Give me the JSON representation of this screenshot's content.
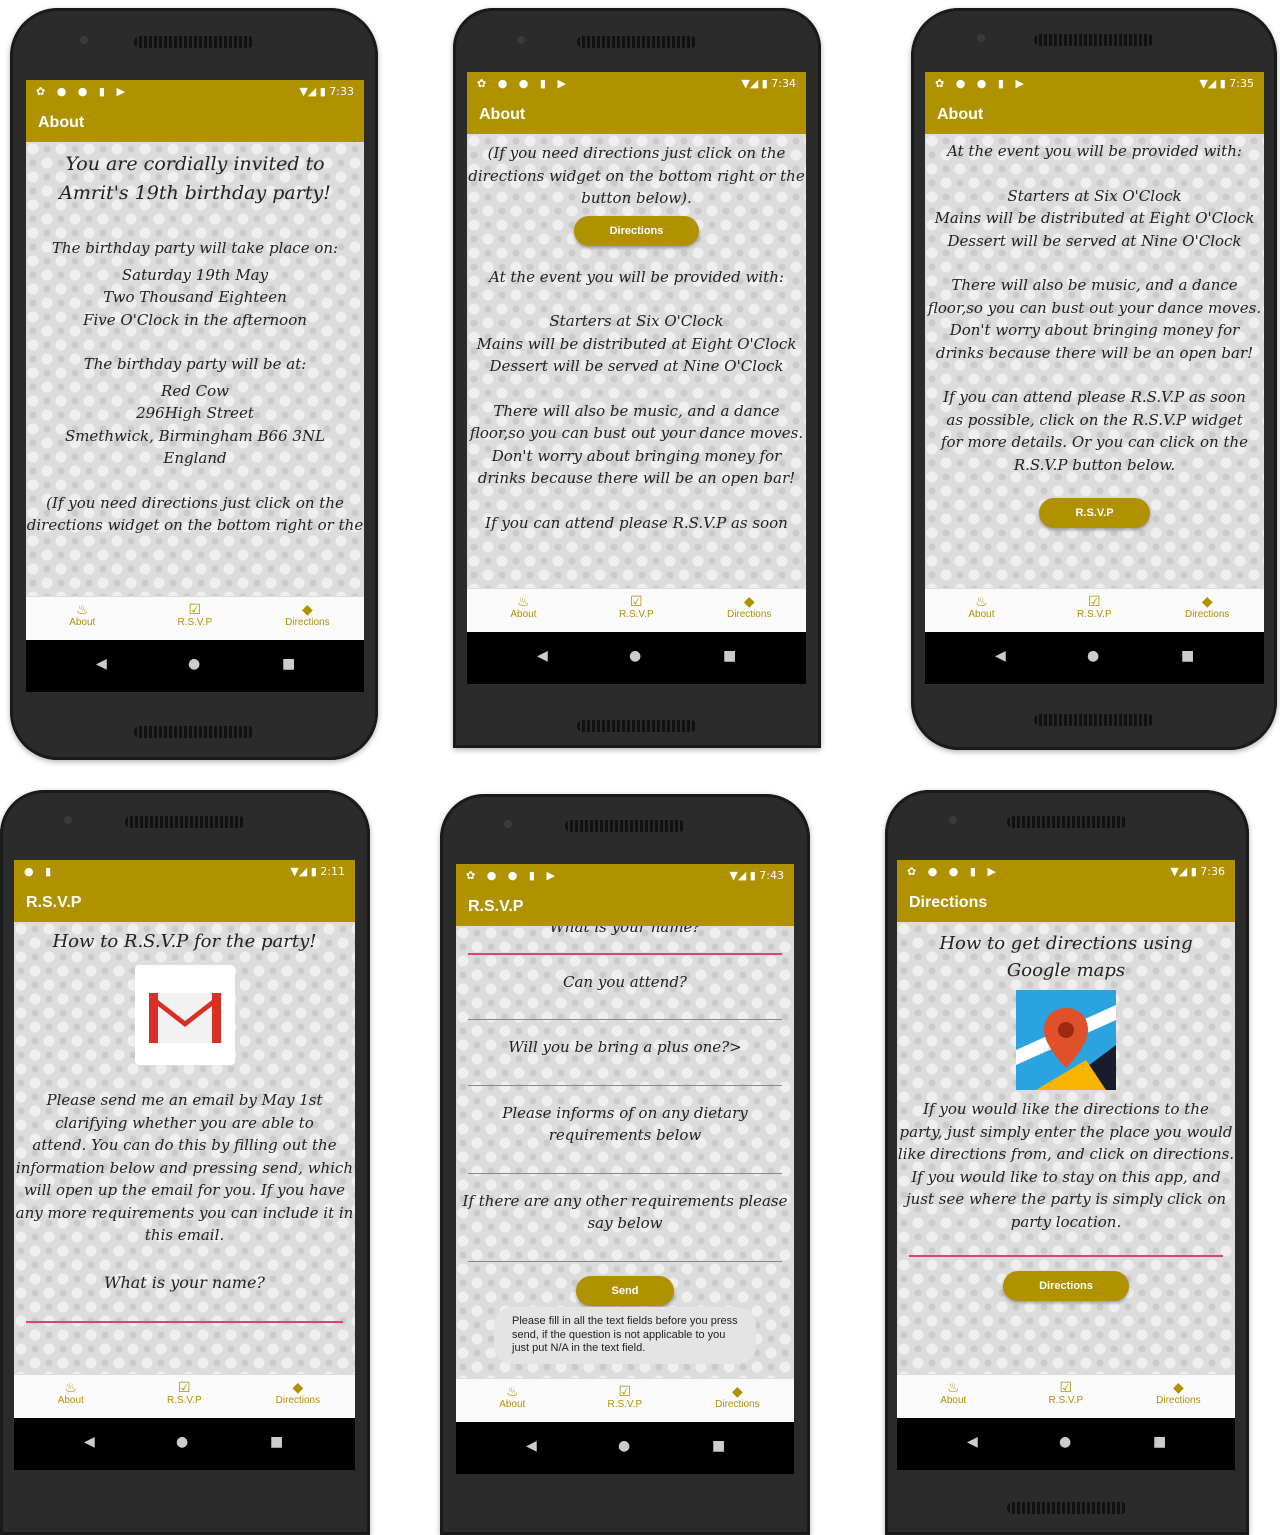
{
  "nav": {
    "about": "About",
    "rsvp": "R.S.V.P",
    "directions": "Directions"
  },
  "screens": [
    {
      "time": "7:33",
      "title": "About",
      "heading1": "You are cordially invited to",
      "heading2": "Amrit's 19th birthday party!",
      "p1": "The birthday party will take place on:",
      "p2": "Saturday 19th May",
      "p3": "Two Thousand Eighteen",
      "p4": "Five O'Clock in the afternoon",
      "p5": "The birthday party will be at:",
      "p6": "Red Cow",
      "p7": "296High Street",
      "p8": "Smethwick, Birmingham B66 3NL",
      "p9": "England",
      "p10": "(If you need directions just click on the",
      "p11": "directions widget on the bottom right or the"
    },
    {
      "time": "7:34",
      "title": "About",
      "p1": "(If you need directions just click on the",
      "p2": "directions widget on the bottom right or the",
      "p3": "button below).",
      "button": "Directions",
      "p4": "At the event you will be provided with:",
      "p5": "Starters at Six O'Clock",
      "p6": "Mains will be distributed at Eight O'Clock",
      "p7": "Dessert will be served at Nine O'Clock",
      "p8": "There will also be music, and a dance",
      "p9": "floor,so you can bust out your dance moves.",
      "p10": "Don't worry about bringing money for",
      "p11": "drinks because there will be an open bar!",
      "p12": "If you can attend please R.S.V.P as soon"
    },
    {
      "time": "7:35",
      "title": "About",
      "p1": "At the event you will be provided with:",
      "p2": "Starters at Six O'Clock",
      "p3": "Mains will be distributed at Eight O'Clock",
      "p4": "Dessert will be served at Nine O'Clock",
      "p5": "There will also be music, and a dance",
      "p6": "floor,so you can bust out your dance moves.",
      "p7": "Don't worry about bringing money for",
      "p8": "drinks because there will be an open bar!",
      "p9": "If you can attend please R.S.V.P as soon",
      "p10": "as possible, click on the R.S.V.P widget",
      "p11": "for more details. Or you can click on the",
      "p12": "R.S.V.P button below.",
      "button": "R.S.V.P"
    },
    {
      "time": "2:11",
      "title": "R.S.V.P",
      "heading": "How to R.S.V.P for the party!",
      "p1": "Please send me an email by May 1st",
      "p2": "clarifying whether you are able to",
      "p3": "attend. You can do this by filling out the",
      "p4": "information below and pressing send, which",
      "p5": "will open up the email for you. If you have",
      "p6": "any more requirements you can include it in",
      "p7": "this email.",
      "q1": "What is your name?"
    },
    {
      "time": "7:43",
      "title": "R.S.V.P",
      "q0": "What is your name?",
      "q1": "Can you attend?",
      "q2": "Will you be bring a plus one?>",
      "q3a": "Please informs of on any dietary",
      "q3b": "requirements below",
      "q4a": "If there are any other requirements please",
      "q4b": "say below",
      "button": "Send",
      "toast": "Please fill in all the text fields before you press send, if the question is not applicable to you just put N/A in the text field."
    },
    {
      "time": "7:36",
      "title": "Directions",
      "heading1": "How to get directions using",
      "heading2": "Google maps",
      "p1": "If you would like the directions to the",
      "p2": "party, just simply enter the place you would",
      "p3": "like directions from, and click on directions.",
      "p4": "If you would like to stay on this app, and",
      "p5": "just see where the party is simply click on",
      "p6": "party location.",
      "button": "Directions"
    }
  ],
  "colors": {
    "accent": "#b09200",
    "background": "#dcdcdc",
    "field_active": "#e0407a"
  }
}
